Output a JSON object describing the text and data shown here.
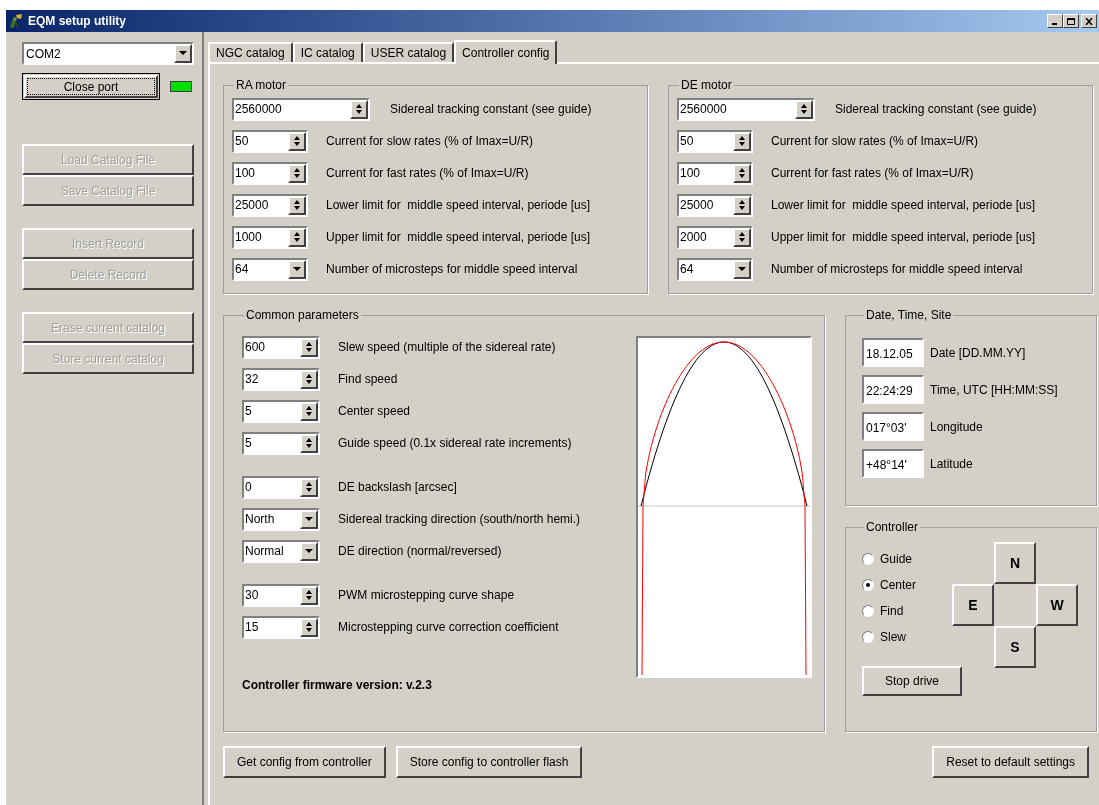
{
  "window": {
    "title": "EQM setup utility"
  },
  "port": {
    "value": "COM2",
    "connected": true
  },
  "close_port": "Close port",
  "side_buttons": [
    [
      {
        "label": "Load Catalog File",
        "disabled": true
      },
      {
        "label": "Save Catalog File",
        "disabled": true
      }
    ],
    [
      {
        "label": "Insert Record",
        "disabled": true
      },
      {
        "label": "Delete Record",
        "disabled": true
      }
    ],
    [
      {
        "label": "Erase current catalog",
        "disabled": true
      },
      {
        "label": "Store current catalog",
        "disabled": true
      }
    ]
  ],
  "tabs": [
    {
      "label": "NGC catalog",
      "selected": false
    },
    {
      "label": "IC catalog",
      "selected": false
    },
    {
      "label": "USER catalog",
      "selected": false
    },
    {
      "label": "Controller config",
      "selected": true
    }
  ],
  "motors": [
    {
      "title": "RA motor",
      "rows": [
        {
          "kind": "spin_wide",
          "value": "2560000",
          "label": "Sidereal tracking constant (see guide)"
        },
        {
          "kind": "spin",
          "value": "50",
          "label": "Current for slow rates (% of Imax=U/R)"
        },
        {
          "kind": "spin",
          "value": "100",
          "label": "Current for fast rates (% of Imax=U/R)"
        },
        {
          "kind": "spin",
          "value": "25000",
          "label": "Lower limit for  middle speed interval, periode [us]"
        },
        {
          "kind": "spin",
          "value": "1000",
          "label": "Upper limit for  middle speed interval, periode [us]"
        },
        {
          "kind": "combo",
          "value": "64",
          "label": "Number of microsteps for middle speed interval"
        }
      ]
    },
    {
      "title": "DE motor",
      "rows": [
        {
          "kind": "spin_wide",
          "value": "2560000",
          "label": "Sidereal tracking constant (see guide)"
        },
        {
          "kind": "spin",
          "value": "50",
          "label": "Current for slow rates (% of Imax=U/R)"
        },
        {
          "kind": "spin",
          "value": "100",
          "label": "Current for fast rates (% of Imax=U/R)"
        },
        {
          "kind": "spin",
          "value": "25000",
          "label": "Lower limit for  middle speed interval, periode [us]"
        },
        {
          "kind": "spin",
          "value": "2000",
          "label": "Upper limit for  middle speed interval, periode [us]"
        },
        {
          "kind": "combo",
          "value": "64",
          "label": "Number of microsteps for middle speed interval"
        }
      ]
    }
  ],
  "common": {
    "title": "Common parameters",
    "groups": [
      {
        "rows": [
          {
            "kind": "spin",
            "value": "600",
            "label": "Slew speed (multiple of the sidereal rate)"
          },
          {
            "kind": "spin",
            "value": "32",
            "label": "Find speed"
          },
          {
            "kind": "spin",
            "value": "5",
            "label": "Center speed"
          },
          {
            "kind": "spin",
            "value": "5",
            "label": "Guide speed (0.1x sidereal rate increments)"
          }
        ]
      },
      {
        "rows": [
          {
            "kind": "spin",
            "value": "0",
            "label": "DE backslash [arcsec]"
          },
          {
            "kind": "combo",
            "value": "North",
            "label": "Sidereal tracking direction (south/north hemi.)"
          },
          {
            "kind": "combo",
            "value": "Normal",
            "label": "DE direction (normal/reversed)"
          }
        ]
      },
      {
        "rows": [
          {
            "kind": "spin",
            "value": "30",
            "label": "PWM microstepping curve shape"
          },
          {
            "kind": "spin",
            "value": "15",
            "label": "Microstepping curve correction coefficient"
          }
        ]
      }
    ],
    "firmware": "Controller firmware version: v.2.3"
  },
  "site": {
    "title": "Date, Time, Site",
    "rows": [
      {
        "value": "18.12.05",
        "label": "Date [DD.MM.YY]"
      },
      {
        "value": "22:24:29",
        "label": "Time, UTC [HH:MM:SS]"
      },
      {
        "value": "017°03'",
        "label": "Longitude"
      },
      {
        "value": "+48°14'",
        "label": "Latitude"
      }
    ]
  },
  "controller": {
    "title": "Controller",
    "modes": [
      {
        "label": "Guide",
        "selected": false
      },
      {
        "label": "Center",
        "selected": true
      },
      {
        "label": "Find",
        "selected": false
      },
      {
        "label": "Slew",
        "selected": false
      }
    ],
    "directions": [
      {
        "label": "N"
      },
      {
        "label": "E"
      },
      {
        "label": "W"
      },
      {
        "label": "S"
      }
    ],
    "stop": "Stop drive"
  },
  "left_buttons": [
    "Get config from controller",
    "Store config to controller flash"
  ],
  "right_buttons": [
    "Reset to default settings"
  ]
}
